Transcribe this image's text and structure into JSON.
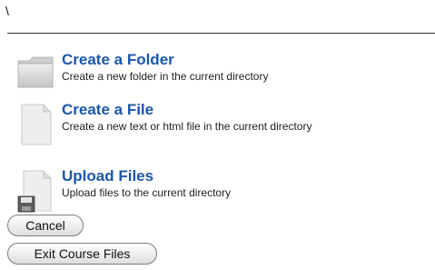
{
  "path": "\\",
  "actions": [
    {
      "title": "Create a Folder",
      "description": "Create a new folder in the current directory",
      "icon": "folder-icon"
    },
    {
      "title": "Create a File",
      "description": "Create a new text or html file in the current directory",
      "icon": "file-icon"
    },
    {
      "title": "Upload Files",
      "description": "Upload files to the current directory",
      "icon": "upload-icon"
    }
  ],
  "buttons": {
    "cancel": "Cancel",
    "exit": "Exit Course Files"
  }
}
